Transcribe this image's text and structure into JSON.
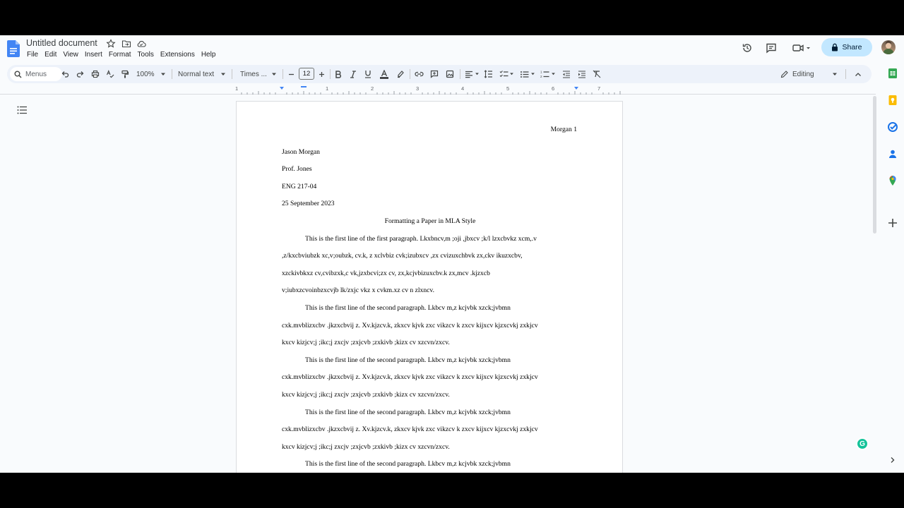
{
  "document": {
    "title": "Untitled document"
  },
  "menubar": {
    "items": [
      "File",
      "Edit",
      "View",
      "Insert",
      "Format",
      "Tools",
      "Extensions",
      "Help"
    ]
  },
  "header": {
    "share_label": "Share"
  },
  "toolbar": {
    "menus_label": "Menus",
    "zoom": "100%",
    "style": "Normal text",
    "font": "Times ...",
    "font_size": "12",
    "mode": "Editing"
  },
  "ruler": {
    "labels": [
      "1",
      "1",
      "2",
      "3",
      "4",
      "5",
      "6",
      "7"
    ]
  },
  "page": {
    "header_text": "Morgan 1",
    "heading_lines": [
      "Jason Morgan",
      "Prof. Jones",
      "ENG 217-04",
      "25 September 2023"
    ],
    "title": "Formatting a Paper in MLA Style",
    "body_lines": [
      "This is the first line of the first paragraph. Lkxbncv,m ;oji ,jbxcv ;k/l lzxcbvkz xcm,.v",
      ",z/kxcbviubzk xc,v;oubzk, cv.k, z xclvbiz cvk;izubxcv ,zx cvizuxchbvk zx,ckv ikuzxcbv,",
      "xzckivbkxz cv,cvibzxk,c vk,jzxbcvi;zx cv, zx,kcjvbizuxcbv.k zx,mcv .kjzxcb",
      "v;iubxzcvoinbzxcvjb lk/zxjc vkz x cvkm.xz cv n zlxncv.",
      "This is the first line of the second paragraph. Lkbcv m,z kcjvbk  xzck;jvbmn",
      "cxk.mvblizxcbv  .jkzxcbvij z. Xv.kjzcv.k, zkxcv kjvk zxc vikzcv k zxcv kijxcv kjzxcvkj zxkjcv",
      "kxcv kizjcv;j ;ikc;j zxcjv ;zxjcvb ;zxkivb ;kizx cv xzcvn/zxcv.",
      "This is the first line of the second paragraph. Lkbcv m,z kcjvbk  xzck;jvbmn",
      "cxk.mvblizxcbv  .jkzxcbvij z. Xv.kjzcv.k, zkxcv kjvk zxc vikzcv k zxcv kijxcv kjzxcvkj zxkjcv",
      "kxcv kizjcv;j ;ikc;j zxcjv ;zxjcvb ;zxkivb ;kizx cv xzcvn/zxcv.",
      "This is the first line of the second paragraph. Lkbcv m,z kcjvbk  xzck;jvbmn",
      "cxk.mvblizxcbv  .jkzxcbvij z. Xv.kjzcv.k, zkxcv kjvk zxc vikzcv k zxcv kijxcv kjzxcvkj zxkjcv",
      "kxcv kizjcv;j ;ikc;j zxcjv ;zxjcvb ;zxkivb ;kizx cv xzcvn/zxcv.",
      "This is the first line of the second paragraph. Lkbcv m,z kcjvbk  xzck;jvbmn"
    ]
  },
  "colors": {
    "share_bg": "#c2e7ff",
    "toolbar_bg": "#edf2fa",
    "docs_blue": "#4285f4"
  }
}
